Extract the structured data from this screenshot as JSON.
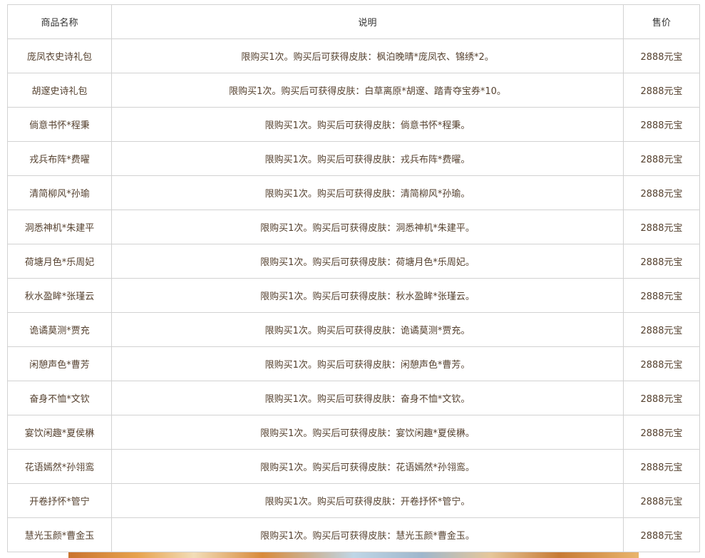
{
  "table": {
    "headers": [
      "商品名称",
      "说明",
      "售价"
    ],
    "rows": [
      {
        "name": "庞凤衣史诗礼包",
        "desc": "限购买1次。购买后可获得皮肤：枫泊晚晴*庞凤衣、锦绣*2。",
        "price": "2888元宝"
      },
      {
        "name": "胡邃史诗礼包",
        "desc": "限购买1次。购买后可获得皮肤：白草离原*胡邃、踏青夺宝券*10。",
        "price": "2888元宝"
      },
      {
        "name": "倘意书怀*程秉",
        "desc": "限购买1次。购买后可获得皮肤：倘意书怀*程秉。",
        "price": "2888元宝"
      },
      {
        "name": "戎兵布阵*费曜",
        "desc": "限购买1次。购买后可获得皮肤：戎兵布阵*费曜。",
        "price": "2888元宝"
      },
      {
        "name": "清简柳风*孙瑜",
        "desc": "限购买1次。购买后可获得皮肤：清简柳风*孙瑜。",
        "price": "2888元宝"
      },
      {
        "name": "洞悉神机*朱建平",
        "desc": "限购买1次。购买后可获得皮肤：洞悉神机*朱建平。",
        "price": "2888元宝"
      },
      {
        "name": "荷塘月色*乐周妃",
        "desc": "限购买1次。购买后可获得皮肤：荷塘月色*乐周妃。",
        "price": "2888元宝"
      },
      {
        "name": "秋水盈眸*张瑾云",
        "desc": "限购买1次。购买后可获得皮肤：秋水盈眸*张瑾云。",
        "price": "2888元宝"
      },
      {
        "name": "诡谲莫测*贾充",
        "desc": "限购买1次。购买后可获得皮肤：诡谲莫测*贾充。",
        "price": "2888元宝"
      },
      {
        "name": "闲憩声色*曹芳",
        "desc": "限购买1次。购买后可获得皮肤：闲憩声色*曹芳。",
        "price": "2888元宝"
      },
      {
        "name": "奋身不恤*文钦",
        "desc": "限购买1次。购买后可获得皮肤：奋身不恤*文钦。",
        "price": "2888元宝"
      },
      {
        "name": "宴饮闲趣*夏侯楙",
        "desc": "限购买1次。购买后可获得皮肤：宴饮闲趣*夏侯楙。",
        "price": "2888元宝"
      },
      {
        "name": "花语嫣然*孙翎鸾",
        "desc": "限购买1次。购买后可获得皮肤：花语嫣然*孙翎鸾。",
        "price": "2888元宝"
      },
      {
        "name": "开卷抒怀*管宁",
        "desc": "限购买1次。购买后可获得皮肤：开卷抒怀*管宁。",
        "price": "2888元宝"
      },
      {
        "name": "慧光玉颜*曹金玉",
        "desc": "限购买1次。购买后可获得皮肤：慧光玉颜*曹金玉。",
        "price": "2888元宝"
      }
    ]
  }
}
